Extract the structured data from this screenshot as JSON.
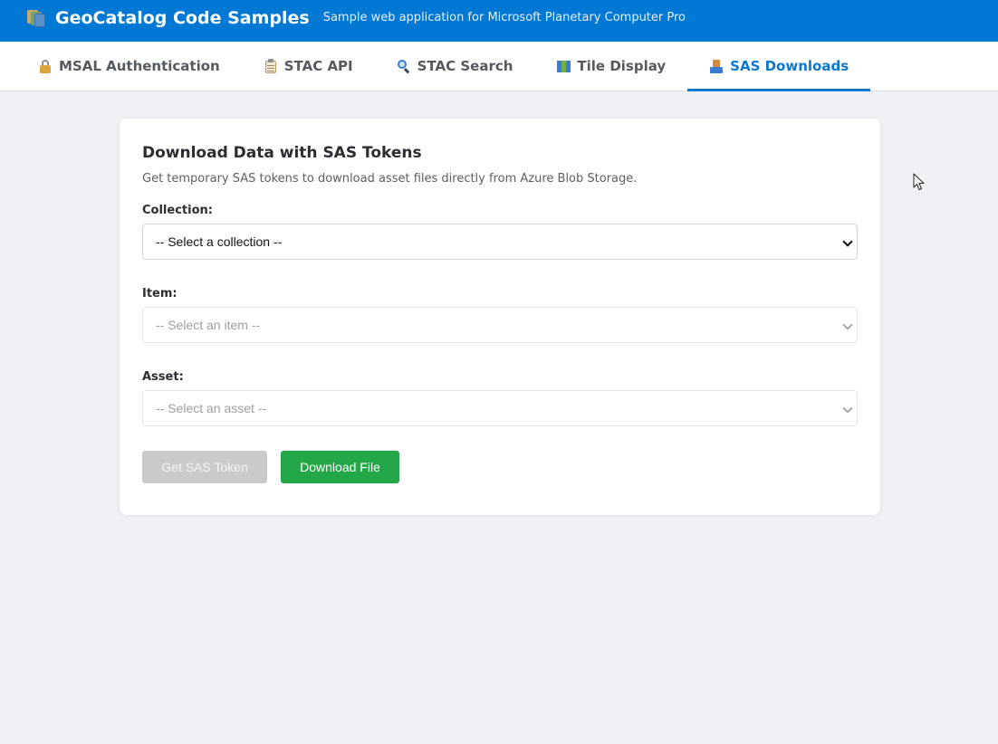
{
  "header": {
    "title": "GeoCatalog Code Samples",
    "subtitle": "Sample web application for Microsoft Planetary Computer Pro",
    "logo_icon": "books-icon",
    "background_color": "#0078d4"
  },
  "tabs": [
    {
      "label": "MSAL Authentication",
      "icon": "lock-icon",
      "active": false
    },
    {
      "label": "STAC API",
      "icon": "clipboard-icon",
      "active": false
    },
    {
      "label": "STAC Search",
      "icon": "magnifier-icon",
      "active": false
    },
    {
      "label": "Tile Display",
      "icon": "map-icon",
      "active": false
    },
    {
      "label": "SAS Downloads",
      "icon": "inbox-tray-icon",
      "active": true
    }
  ],
  "card": {
    "title": "Download Data with SAS Tokens",
    "description": "Get temporary SAS tokens to download asset files directly from Azure Blob Storage.",
    "collection": {
      "label": "Collection:",
      "selected": "-- Select a collection --",
      "enabled": true
    },
    "item": {
      "label": "Item:",
      "selected": "-- Select an item --",
      "enabled": false
    },
    "asset": {
      "label": "Asset:",
      "selected": "-- Select an asset --",
      "enabled": false
    },
    "buttons": {
      "get_sas_token": "Get SAS Token",
      "download_file": "Download File"
    }
  },
  "colors": {
    "accent": "#0a78d0",
    "download_button": "#24a748",
    "disabled_button": "#c9cacc",
    "page_background": "#f0f1f4"
  }
}
